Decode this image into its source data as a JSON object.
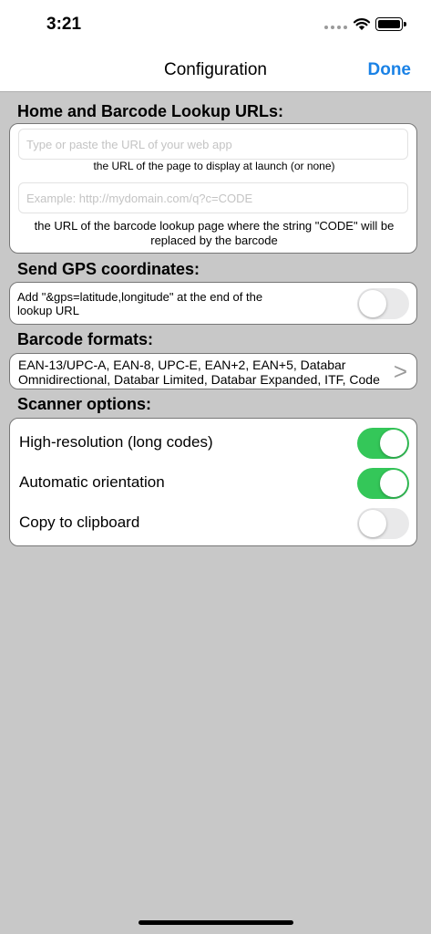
{
  "status": {
    "time": "3:21"
  },
  "nav": {
    "title": "Configuration",
    "done_label": "Done"
  },
  "urls": {
    "section_title": "Home and Barcode Lookup URLs:",
    "home_placeholder": "Type or paste the URL of your web app",
    "home_value": "",
    "home_hint": "the URL of the page to display at launch (or none)",
    "lookup_placeholder": "Example: http://mydomain.com/q?c=CODE",
    "lookup_value": "",
    "lookup_hint": "the URL of the barcode lookup page where the string \"CODE\" will be replaced by the barcode"
  },
  "gps": {
    "section_title": "Send GPS coordinates:",
    "description": "Add \"&gps=latitude,longitude\" at the end of the lookup URL",
    "enabled": false
  },
  "formats": {
    "section_title": "Barcode formats:",
    "value": "EAN-13/UPC-A, EAN-8, UPC-E, EAN+2, EAN+5, Databar Omnidirectional, Databar Limited, Databar Expanded, ITF, Code",
    "chevron_icon": "chevron-right-icon"
  },
  "scanner": {
    "section_title": "Scanner options:",
    "options": [
      {
        "label": "High-resolution (long codes)",
        "enabled": true
      },
      {
        "label": "Automatic orientation",
        "enabled": true
      },
      {
        "label": "Copy to clipboard",
        "enabled": false
      }
    ]
  },
  "colors": {
    "accent": "#1a82e6",
    "toggle_on": "#34c759",
    "background": "#c8c8c8"
  }
}
